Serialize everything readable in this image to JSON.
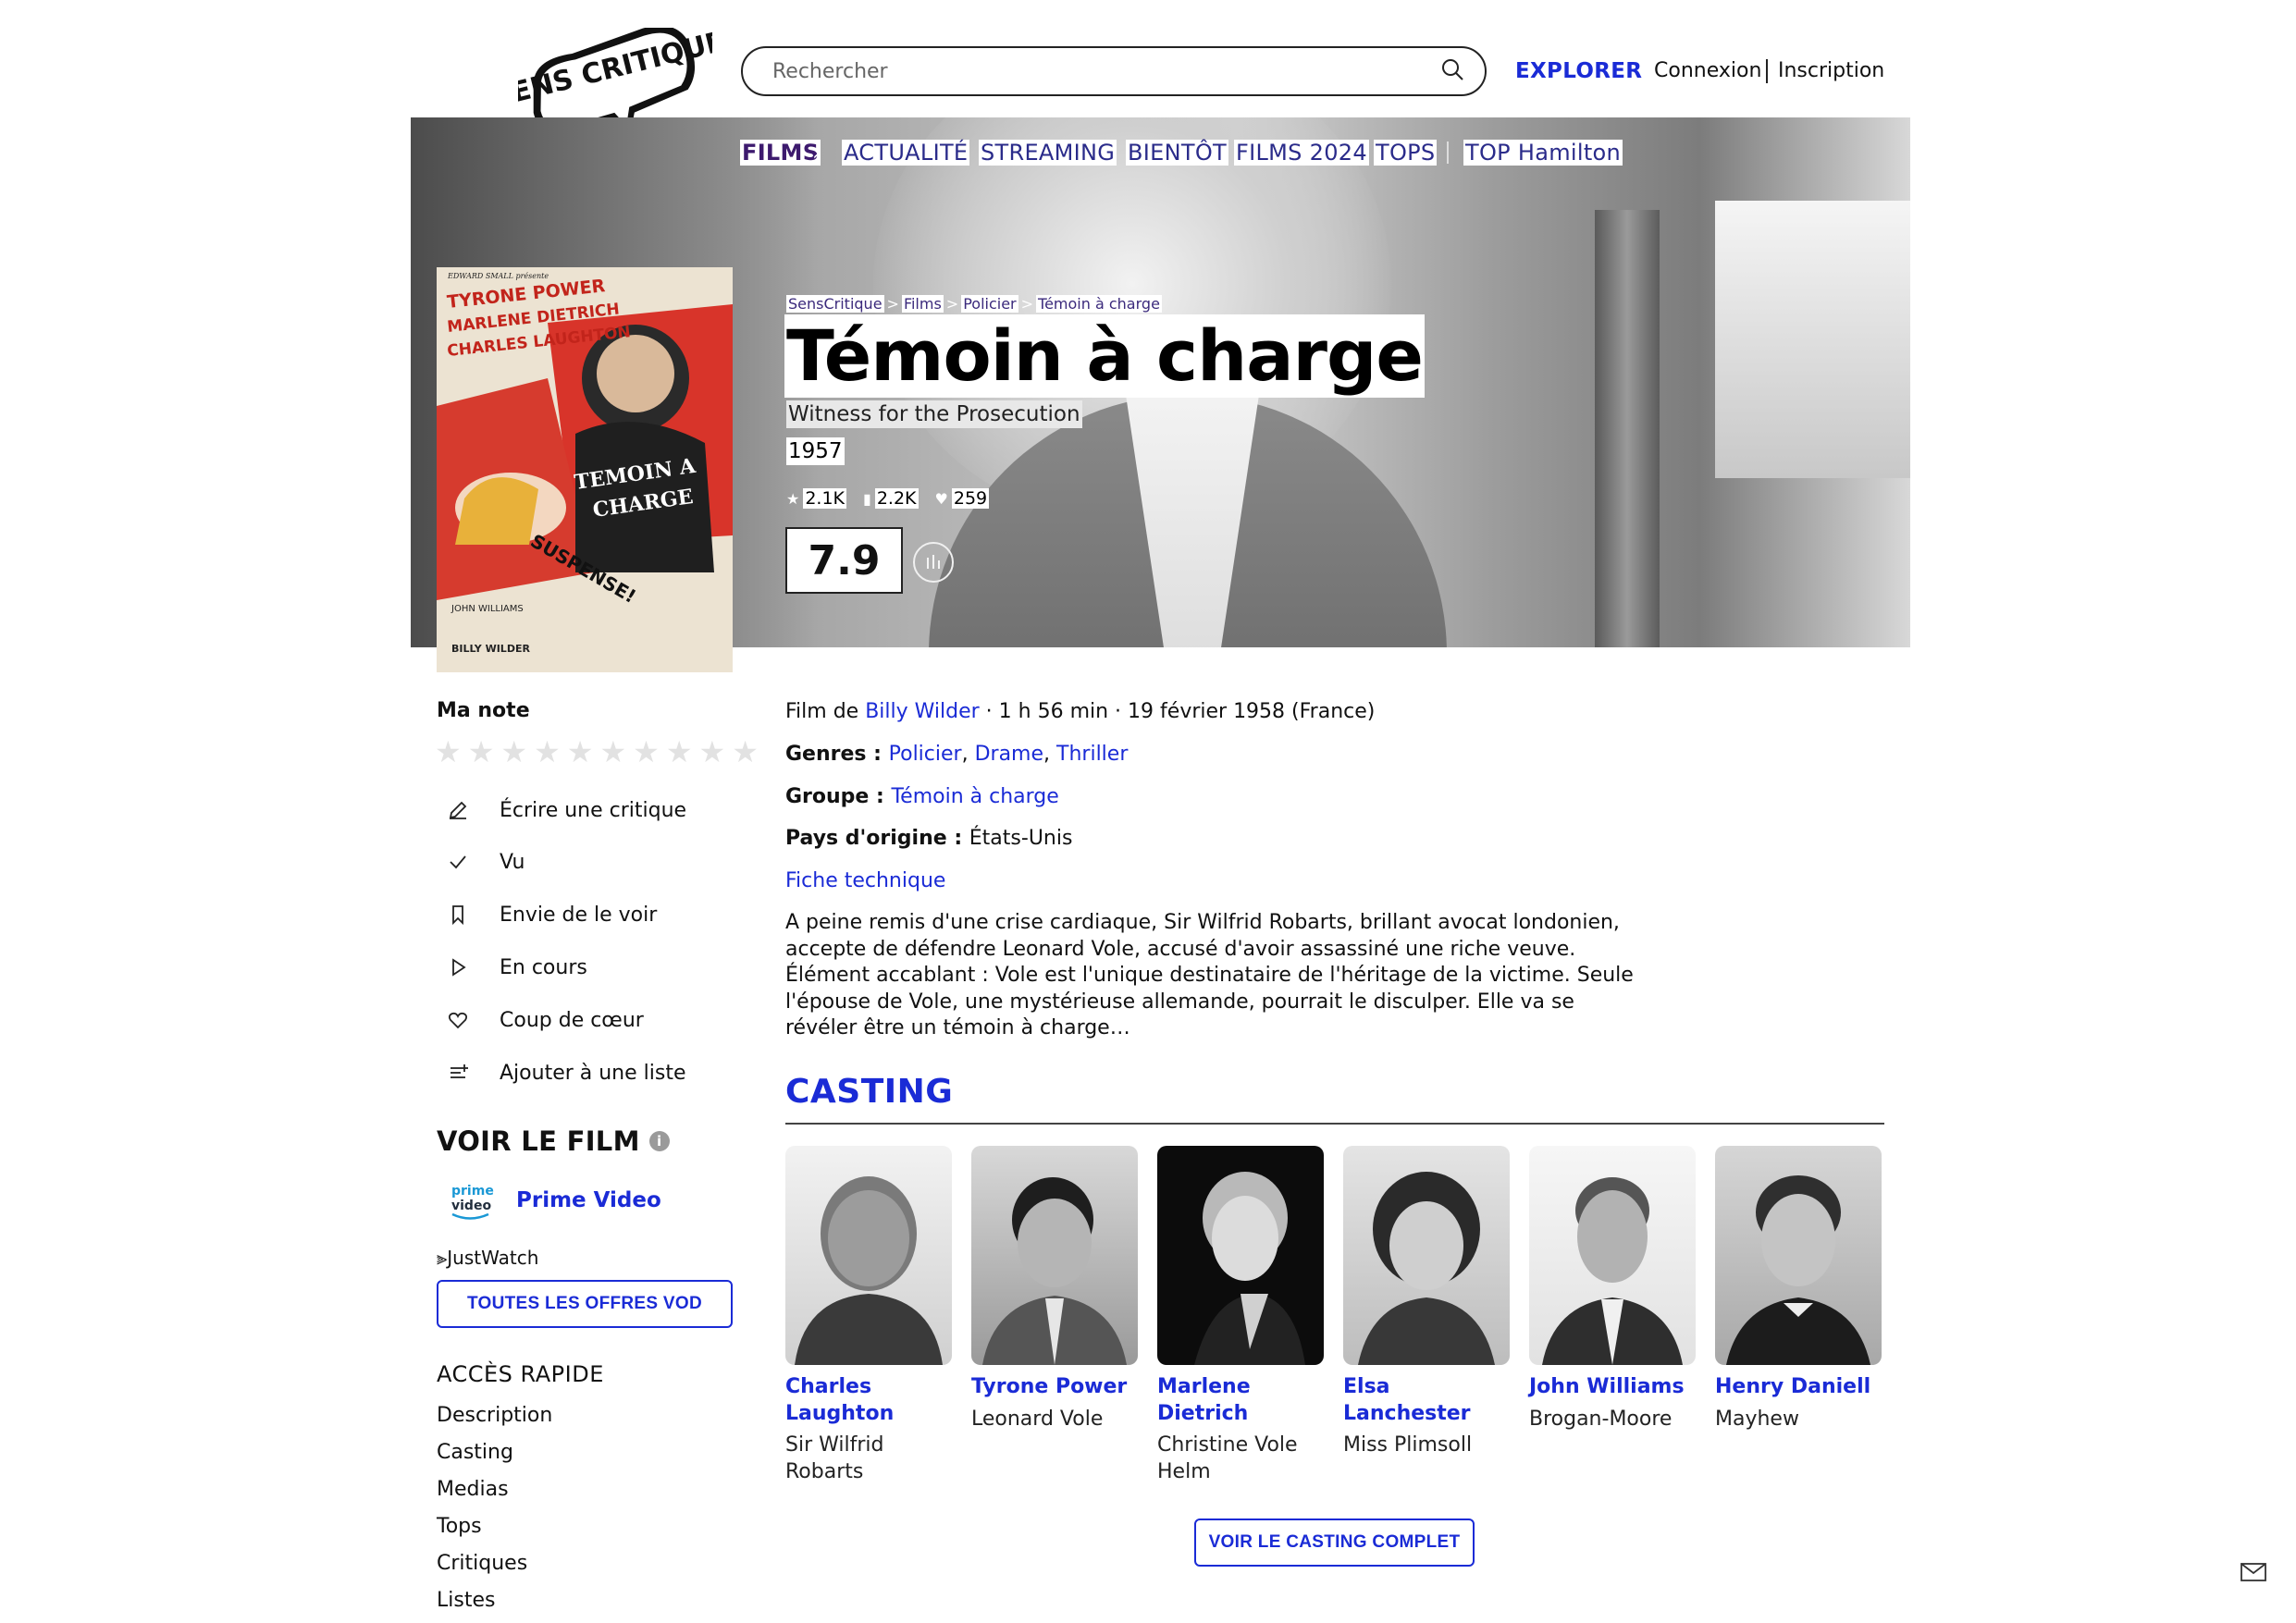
{
  "header": {
    "logo_text": "SENS CRITIQUE",
    "search_placeholder": "Rechercher",
    "explore_label": "EXPLORER",
    "login_label": "Connexion",
    "signup_label": "Inscription"
  },
  "nav": {
    "items": [
      "FILMS",
      "ACTUALITÉ",
      "STREAMING",
      "BIENTÔT",
      "FILMS 2024",
      "TOPS",
      "TOP Hamilton"
    ],
    "chevron": "›"
  },
  "breadcrumb": {
    "items": [
      "SensCritique",
      "Films",
      "Policier",
      "Témoin à charge"
    ],
    "separator": ">"
  },
  "movie": {
    "title": "Témoin à charge",
    "original_title": "Witness for the Prosecution",
    "year": "1957",
    "ratings_count": "2.1K",
    "wishlist_count": "2.2K",
    "likes_count": "259",
    "score": "7.9",
    "poster": {
      "line1": "TYRONE POWER",
      "line2": "MARLENE DIETRICH",
      "line3": "CHARLES LAUGHTON",
      "title1": "TEMOIN A",
      "title2": "CHARGE",
      "tag": "SUSPENSE!",
      "credit1": "JOHN WILLIAMS",
      "credit2": "BILLY WILDER",
      "producer": "EDWARD SMALL présente"
    }
  },
  "sidebar": {
    "my_rating_label": "Ma note",
    "stars": [
      "★",
      "★",
      "★",
      "★",
      "★",
      "★",
      "★",
      "★",
      "★",
      "★"
    ],
    "actions": [
      {
        "label": "Écrire une critique",
        "icon": "pencil-icon"
      },
      {
        "label": "Vu",
        "icon": "check-icon"
      },
      {
        "label": "Envie de le voir",
        "icon": "bookmark-icon"
      },
      {
        "label": "En cours",
        "icon": "play-icon"
      },
      {
        "label": "Coup de cœur",
        "icon": "heart-icon"
      },
      {
        "label": "Ajouter à une liste",
        "icon": "list-add-icon"
      }
    ],
    "watch_title": "VOIR LE FILM",
    "info_glyph": "i",
    "prime_logo_line1": "prime",
    "prime_logo_line2": "video",
    "provider_label": "Prime Video",
    "justwatch_label": "JustWatch",
    "vod_button": "TOUTES LES OFFRES VOD",
    "quick_access_title": "ACCÈS RAPIDE",
    "quick_links": [
      "Description",
      "Casting",
      "Medias",
      "Tops",
      "Critiques",
      "Listes"
    ]
  },
  "details": {
    "film_by_prefix": "Film de ",
    "director": "Billy Wilder",
    "meta": " · 1 h 56 min · 19 février 1958 (France)",
    "genres_label": "Genres : ",
    "genres": [
      "Policier",
      "Drame",
      "Thriller"
    ],
    "group_label": "Groupe : ",
    "group": "Témoin à charge",
    "country_label": "Pays d'origine : ",
    "country": "États-Unis",
    "tech_sheet_link": "Fiche technique",
    "synopsis": "A peine remis d'une crise cardiaque, Sir Wilfrid Robarts, brillant avocat londonien, accepte de défendre Leonard Vole, accusé d'avoir assassiné une riche veuve. Élément accablant : Vole est l'unique destinataire de l'héritage de la victime. Seule l'épouse de Vole, une mystérieuse allemande, pourrait le disculper. Elle va se révéler être un témoin à charge…"
  },
  "casting": {
    "title": "CASTING",
    "actors": [
      {
        "name": "Charles Laughton",
        "role": "Sir Wilfrid Robarts"
      },
      {
        "name": "Tyrone Power",
        "role": "Leonard Vole"
      },
      {
        "name": "Marlene Dietrich",
        "role": "Christine Vole Helm"
      },
      {
        "name": "Elsa Lanchester",
        "role": "Miss Plimsoll"
      },
      {
        "name": "John Williams",
        "role": "Brogan-Moore"
      },
      {
        "name": "Henry Daniell",
        "role": "Mayhew"
      }
    ],
    "full_cast_button": "VOIR LE CASTING COMPLET"
  },
  "colors": {
    "accent": "#1a2bd6",
    "nav_text": "#2a2b8a",
    "films_nav": "#3d1a6e"
  }
}
